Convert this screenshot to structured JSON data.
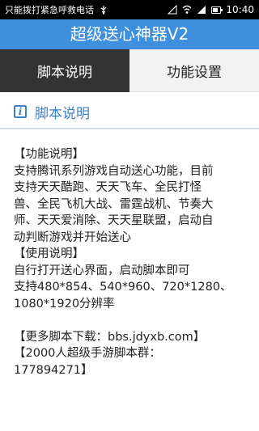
{
  "status_bar": {
    "notification_text": "只能拨打紧急呼救电话",
    "time": "10:40"
  },
  "app": {
    "title": "超级送心神器V2"
  },
  "tabs": [
    {
      "label": "脚本说明",
      "active": true
    },
    {
      "label": "功能设置",
      "active": false
    }
  ],
  "section": {
    "title": "脚本说明"
  },
  "content": {
    "line1": "【功能说明】",
    "line2": "支持腾讯系列游戏自动送心功能，目前",
    "line3": "支持天天酷跑、天天飞车、全民打怪",
    "line4": "兽、全民飞机大战、雷霆战机、节奏大",
    "line5": "师、天天爱消除、天天星联盟，启动自",
    "line6": "动判断游戏并开始送心",
    "line7": "【使用说明】",
    "line8": "自行打开送心界面，启动脚本即可",
    "line9": "支持480*854、540*960、720*1280、",
    "line10": "1080*1920分辨率",
    "line11": "【更多脚本下载：bbs.jdyxb.com】",
    "line12": "【2000人超级手游脚本群：",
    "line13": "177894271】"
  },
  "colors": {
    "title_bar": "#3f8fdf",
    "active_tab": "#333333",
    "accent": "#3c82c8"
  }
}
